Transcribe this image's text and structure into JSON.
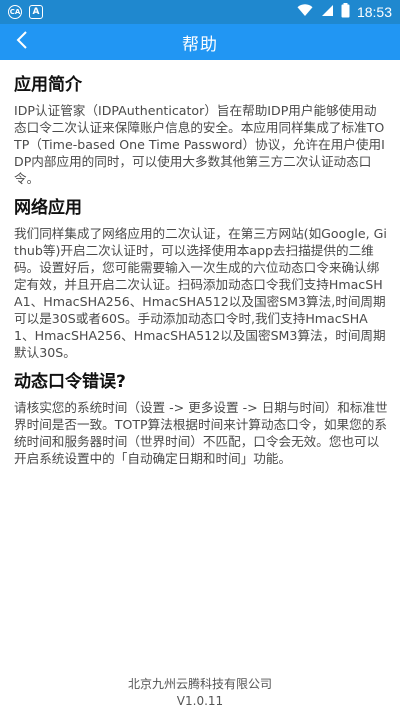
{
  "status_bar": {
    "left_badges": [
      "CA",
      "A"
    ],
    "time": "18:53",
    "icons": [
      "wifi-icon",
      "signal-icon",
      "battery-icon"
    ]
  },
  "app_bar": {
    "back_icon": "chevron-left-icon",
    "title": "帮助"
  },
  "sections": [
    {
      "title": "应用简介",
      "body": "IDP认证管家（IDPAuthenticator）旨在帮助IDP用户能够使用动态口令二次认证来保障账户信息的安全。本应用同样集成了标准TOTP（Time-based One Time Password）协议，允许在用户使用IDP内部应用的同时，可以使用大多数其他第三方二次认证动态口令。"
    },
    {
      "title": "网络应用",
      "body": "我们同样集成了网络应用的二次认证，在第三方网站(如Google, Github等)开启二次认证时，可以选择使用本app去扫描提供的二维码。设置好后，您可能需要输入一次生成的六位动态口令来确认绑定有效，并且开启二次认证。扫码添加动态口令我们支持HmacSHA1、HmacSHA256、HmacSHA512以及国密SM3算法,时间周期可以是30S或者60S。手动添加动态口令时,我们支持HmacSHA1、HmacSHA256、HmacSHA512以及国密SM3算法，时间周期默认30S。"
    },
    {
      "title": "动态口令错误?",
      "body": "请核实您的系统时间（设置 -> 更多设置 -> 日期与时间）和标准世界时间是否一致。TOTP算法根据时间来计算动态口令，如果您的系统时间和服务器时间（世界时间）不匹配，口令会无效。您也可以开启系统设置中的「自动确定日期和时间」功能。"
    }
  ],
  "footer": {
    "company": "北京九州云腾科技有限公司",
    "version": "V1.0.11"
  }
}
